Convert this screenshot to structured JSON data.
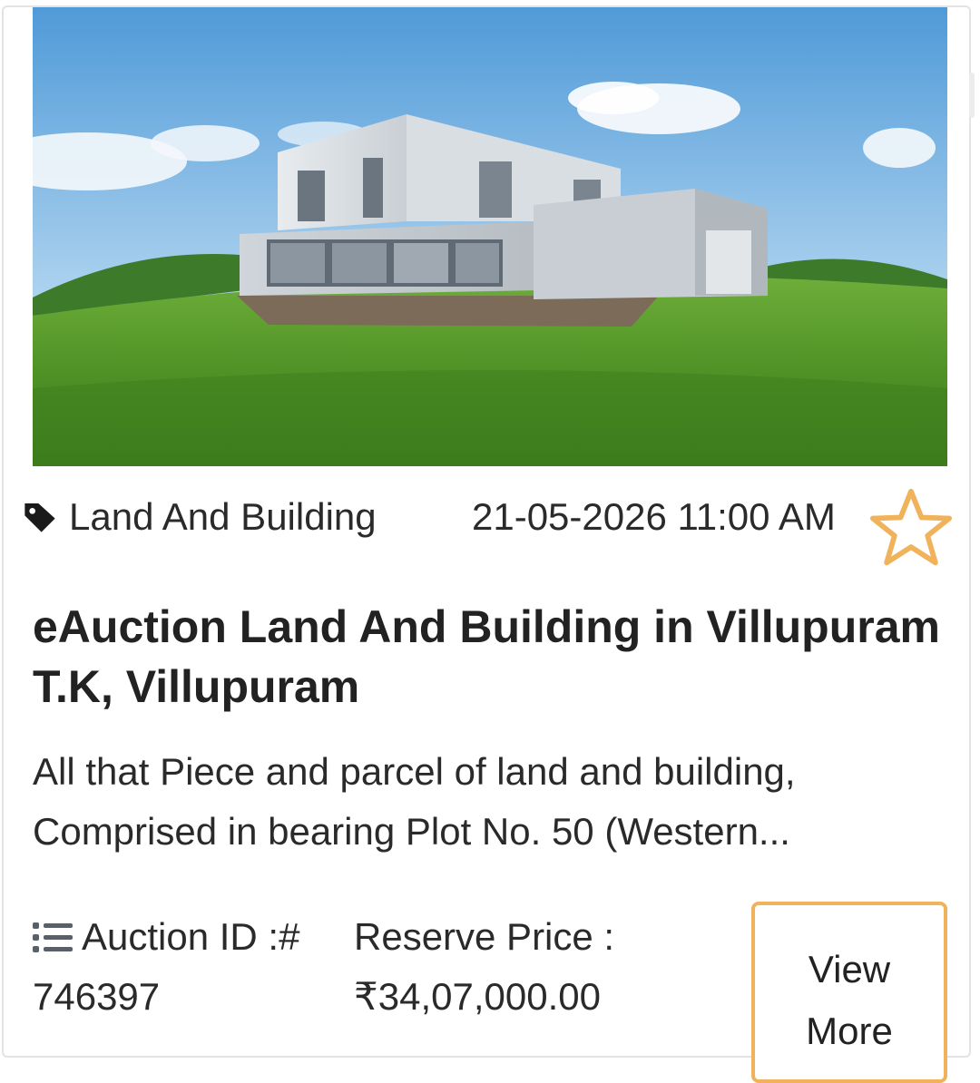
{
  "listing": {
    "image_alt": "Modern two-storey house on green grass hill",
    "category": "Land And Building",
    "auction_datetime": "21-05-2026 11:00 AM",
    "title": "eAuction Land And Building in Villupuram T.K, Villupuram",
    "description": "All that Piece and parcel of land and building, Comprised in bearing Plot No. 50 (Western...",
    "auction_id_label": "Auction ID :#",
    "auction_id": "746397",
    "reserve_price_label": "Reserve Price :",
    "reserve_price": "₹34,07,000.00",
    "view_more_label": "View More"
  },
  "icons": {
    "category": "tag-icon",
    "favorite": "star-outline-icon",
    "auction_id": "list-icon"
  },
  "colors": {
    "accent": "#f0b25a",
    "text": "#2a2a2a",
    "border": "#e3e3e3"
  }
}
